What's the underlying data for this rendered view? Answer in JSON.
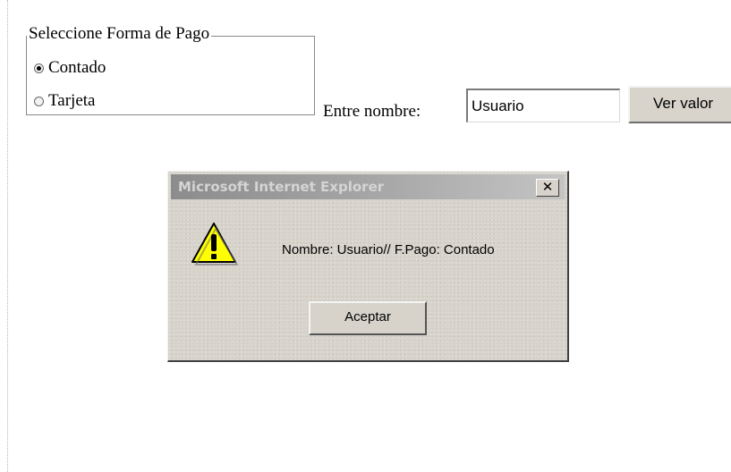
{
  "form": {
    "legend": "Seleccione Forma de Pago",
    "payment_options": [
      {
        "label": "Contado",
        "checked": true
      },
      {
        "label": "Tarjeta",
        "checked": false
      }
    ],
    "name_label": "Entre nombre:",
    "name_value": "Usuario",
    "submit_label": "Ver valor"
  },
  "dialog": {
    "title": "Microsoft Internet Explorer",
    "close_glyph": "✕",
    "icon": "warning-icon",
    "message": "Nombre: Usuario// F.Pago: Contado",
    "ok_label": "Aceptar"
  },
  "colors": {
    "dialog_face": "#d7d3cb",
    "titlebar_inactive": "#8c8c8c",
    "warning_yellow": "#ffff00"
  }
}
